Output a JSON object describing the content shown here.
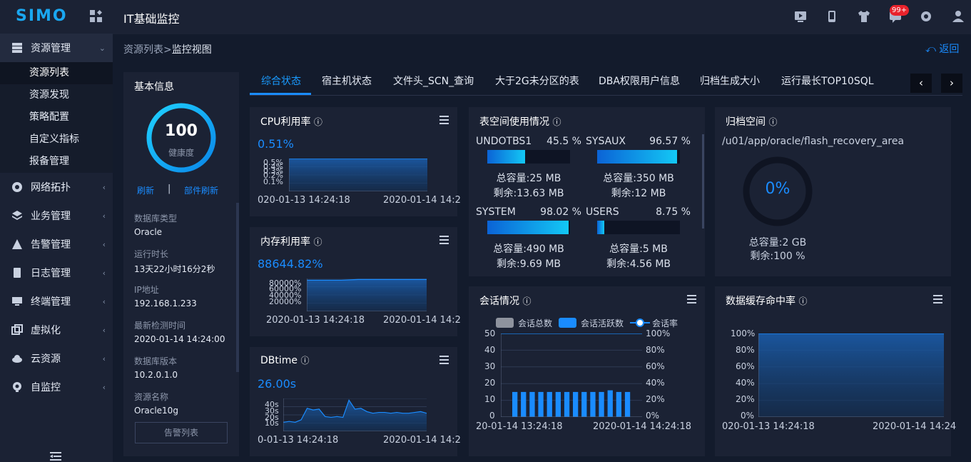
{
  "app": {
    "logo": "SIMO",
    "title": "IT基础监控",
    "badge": "99+"
  },
  "sidebar": {
    "groups": [
      {
        "label": "资源管理",
        "icon": "server-icon"
      },
      {
        "label": "网络拓扑",
        "icon": "network-icon"
      },
      {
        "label": "业务管理",
        "icon": "layers-icon"
      },
      {
        "label": "告警管理",
        "icon": "warning-icon"
      },
      {
        "label": "日志管理",
        "icon": "document-icon"
      },
      {
        "label": "终端管理",
        "icon": "monitor-icon"
      },
      {
        "label": "虚拟化",
        "icon": "virtual-icon"
      },
      {
        "label": "云资源",
        "icon": "cloud-icon"
      },
      {
        "label": "自监控",
        "icon": "target-icon"
      }
    ],
    "subitems": [
      "资源列表",
      "资源发现",
      "策略配置",
      "自定义指标",
      "报备管理"
    ]
  },
  "breadcrumb": {
    "parent": "资源列表>",
    "current": "监控视图"
  },
  "back_label": "返回",
  "basic_info": {
    "title": "基本信息",
    "health_value": "100",
    "health_label": "健康度",
    "refresh": "刷新",
    "sep": "|",
    "part_refresh": "部件刷新",
    "fields": [
      {
        "k": "数据库类型",
        "v": "Oracle"
      },
      {
        "k": "运行时长",
        "v": "13天22小时16分2秒"
      },
      {
        "k": "IP地址",
        "v": "192.168.1.233"
      },
      {
        "k": "最新检测时间",
        "v": "2020-01-14 14:24:00"
      },
      {
        "k": "数据库版本",
        "v": "10.2.0.1.0"
      },
      {
        "k": "资源名称",
        "v": "Oracle10g"
      }
    ],
    "alarm_button": "告警列表"
  },
  "tabs": [
    "综合状态",
    "宿主机状态",
    "文件头_SCN_查询",
    "大于2G未分区的表",
    "DBA权限用户信息",
    "归档生成大小",
    "运行最长TOP10SQL"
  ],
  "cpu": {
    "title": "CPU利用率",
    "value": "0.51%",
    "yticks": [
      "0.5%",
      "0.4%",
      "0.3%",
      "0.2%",
      "0.1%"
    ],
    "x_start": "020-01-13 14:24:18",
    "x_end": "2020-01-14 14:2"
  },
  "mem": {
    "title": "内存利用率",
    "value": "88644.82%",
    "yticks": [
      "80000%",
      "60000%",
      "40000%",
      "20000%"
    ],
    "x_start": "2020-01-13 14:24:18",
    "x_end": "2020-01-14 14:2"
  },
  "dbtime": {
    "title": "DBtime",
    "value": "26.00s",
    "yticks": [
      "40s",
      "30s",
      "20s",
      "10s"
    ],
    "x_start": "0-01-13 14:24:18",
    "x_end": "2020-01-14 14:2"
  },
  "tablespace": {
    "title": "表空间使用情况",
    "items": [
      {
        "name": "UNDOTBS1",
        "pct": "45.5 %",
        "fill": 0.455,
        "total": "总容量:25 MB",
        "remain": "剩余:13.63 MB"
      },
      {
        "name": "SYSAUX",
        "pct": "96.57 %",
        "fill": 0.9657,
        "total": "总容量:350 MB",
        "remain": "剩余:12 MB"
      },
      {
        "name": "SYSTEM",
        "pct": "98.02 %",
        "fill": 0.9802,
        "total": "总容量:490 MB",
        "remain": "剩余:9.69 MB"
      },
      {
        "name": "USERS",
        "pct": "8.75 %",
        "fill": 0.0875,
        "total": "总容量:5 MB",
        "remain": "剩余:4.56 MB"
      }
    ]
  },
  "archive": {
    "title": "归档空间",
    "path": "/u01/app/oracle/flash_recovery_area",
    "pct": "0%",
    "total": "总容量:2 GB",
    "remain": "剩余:100 %"
  },
  "session": {
    "title": "会话情况",
    "legend": [
      "会话总数",
      "会话活跃数",
      "会话率"
    ],
    "yleft": [
      "50",
      "40",
      "30",
      "20",
      "10",
      "0"
    ],
    "yright": [
      "100%",
      "80%",
      "60%",
      "40%",
      "20%",
      "0%"
    ],
    "x_start": "20-01-14 13:24:18",
    "x_end": "2020-01-14 14:24:18"
  },
  "cache": {
    "title": "数据缓存命中率",
    "yticks": [
      "100%",
      "80%",
      "60%",
      "40%",
      "20%",
      "0%"
    ],
    "x_start": "020-01-13 14:24:18",
    "x_end": "2020-01-14 14:24"
  },
  "chart_data": [
    {
      "type": "area",
      "title": "CPU利用率",
      "ylim": [
        0,
        0.5
      ],
      "series": [
        {
          "values": [
            0.5,
            0.5,
            0.5,
            0.5,
            0.5
          ]
        }
      ]
    },
    {
      "type": "area",
      "title": "内存利用率",
      "ylim": [
        0,
        88644.82
      ],
      "series": [
        {
          "values": [
            84000,
            84000,
            84000,
            86000,
            86000,
            86000,
            86000,
            86000
          ]
        }
      ]
    },
    {
      "type": "area",
      "title": "DBtime",
      "ylim": [
        0,
        40
      ],
      "series": [
        {
          "values": [
            11,
            12,
            11,
            14,
            28,
            26,
            27,
            18,
            17,
            18,
            17,
            38,
            27,
            28,
            24,
            22,
            23,
            23,
            22,
            23,
            22,
            22,
            23,
            24,
            22
          ]
        }
      ]
    },
    {
      "type": "bar",
      "title": "会话情况",
      "ylim": [
        0,
        50
      ],
      "series": [
        {
          "name": "会话活跃数",
          "values": [
            15,
            15,
            15,
            15,
            15,
            15,
            15,
            15,
            15,
            15,
            15,
            16,
            15,
            15
          ]
        }
      ]
    },
    {
      "type": "area",
      "title": "数据缓存命中率",
      "ylim": [
        0,
        100
      ],
      "series": [
        {
          "values": [
            100,
            100
          ]
        }
      ]
    }
  ]
}
